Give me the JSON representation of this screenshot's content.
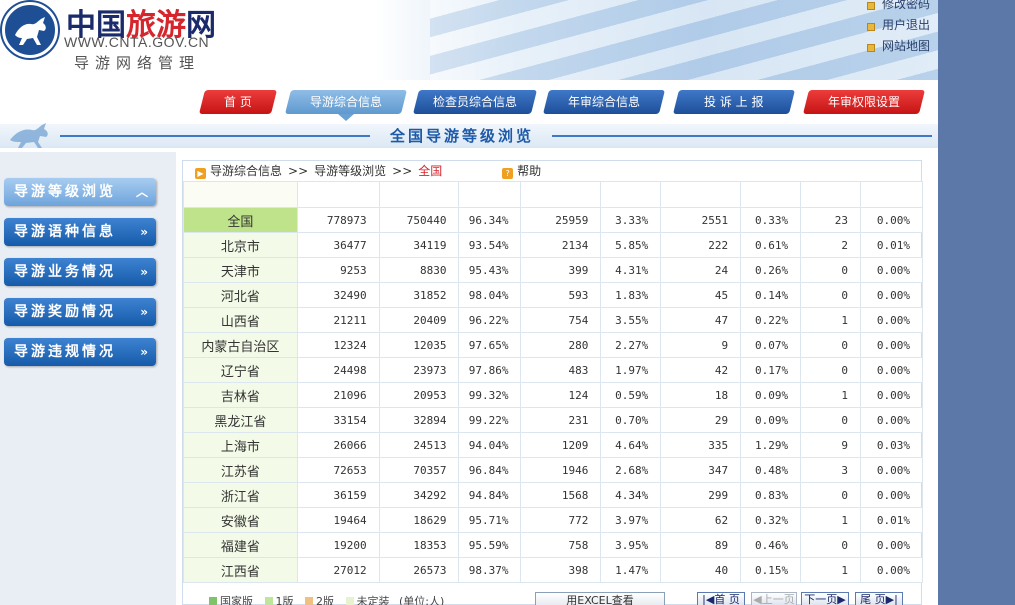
{
  "header": {
    "logo_cn_part1": "中国",
    "logo_cn_part2": "旅游",
    "logo_cn_part3": "网",
    "logo_url": "WWW.CNTA.GOV.CN",
    "logo_sub": "导游网络管理",
    "links": [
      "修改密码",
      "用户退出",
      "网站地图"
    ]
  },
  "nav": {
    "items": [
      "首 页",
      "导游综合信息",
      "检查员综合信息",
      "年审综合信息",
      "投 诉 上 报",
      "年审权限设置"
    ],
    "page_title": "全国导游等级浏览"
  },
  "sidebar": {
    "items": [
      "导游等级浏览",
      "导游语种信息",
      "导游业务情况",
      "导游奖励情况",
      "导游违规情况"
    ]
  },
  "breadcrumb": {
    "a": "导游综合信息",
    "sep": ">>",
    "b": "导游等级浏览",
    "current": "全国",
    "help": "帮助"
  },
  "table": {
    "rows": [
      [
        "全国",
        "778973",
        "750440",
        "96.34%",
        "25959",
        "3.33%",
        "2551",
        "0.33%",
        "23",
        "0.00%"
      ],
      [
        "北京市",
        "36477",
        "34119",
        "93.54%",
        "2134",
        "5.85%",
        "222",
        "0.61%",
        "2",
        "0.01%"
      ],
      [
        "天津市",
        "9253",
        "8830",
        "95.43%",
        "399",
        "4.31%",
        "24",
        "0.26%",
        "0",
        "0.00%"
      ],
      [
        "河北省",
        "32490",
        "31852",
        "98.04%",
        "593",
        "1.83%",
        "45",
        "0.14%",
        "0",
        "0.00%"
      ],
      [
        "山西省",
        "21211",
        "20409",
        "96.22%",
        "754",
        "3.55%",
        "47",
        "0.22%",
        "1",
        "0.00%"
      ],
      [
        "内蒙古自治区",
        "12324",
        "12035",
        "97.65%",
        "280",
        "2.27%",
        "9",
        "0.07%",
        "0",
        "0.00%"
      ],
      [
        "辽宁省",
        "24498",
        "23973",
        "97.86%",
        "483",
        "1.97%",
        "42",
        "0.17%",
        "0",
        "0.00%"
      ],
      [
        "吉林省",
        "21096",
        "20953",
        "99.32%",
        "124",
        "0.59%",
        "18",
        "0.09%",
        "1",
        "0.00%"
      ],
      [
        "黑龙江省",
        "33154",
        "32894",
        "99.22%",
        "231",
        "0.70%",
        "29",
        "0.09%",
        "0",
        "0.00%"
      ],
      [
        "上海市",
        "26066",
        "24513",
        "94.04%",
        "1209",
        "4.64%",
        "335",
        "1.29%",
        "9",
        "0.03%"
      ],
      [
        "江苏省",
        "72653",
        "70357",
        "96.84%",
        "1946",
        "2.68%",
        "347",
        "0.48%",
        "3",
        "0.00%"
      ],
      [
        "浙江省",
        "36159",
        "34292",
        "94.84%",
        "1568",
        "4.34%",
        "299",
        "0.83%",
        "0",
        "0.00%"
      ],
      [
        "安徽省",
        "19464",
        "18629",
        "95.71%",
        "772",
        "3.97%",
        "62",
        "0.32%",
        "1",
        "0.01%"
      ],
      [
        "福建省",
        "19200",
        "18353",
        "95.59%",
        "758",
        "3.95%",
        "89",
        "0.46%",
        "0",
        "0.00%"
      ],
      [
        "江西省",
        "27012",
        "26573",
        "98.37%",
        "398",
        "1.47%",
        "40",
        "0.15%",
        "1",
        "0.00%"
      ]
    ]
  },
  "footer": {
    "legend": [
      "国家版",
      "1版",
      "2版",
      "未定装"
    ],
    "unit": "(单位:人)",
    "excel_label": "用EXCEL查看",
    "first": "首 页",
    "prev": "上一页",
    "next": "下一页",
    "last": "尾 页"
  },
  "colors": {
    "nav_red": "#d41c1c",
    "nav_blue": "#1e4f99",
    "menu_blue": "#165aaa",
    "total_row": "#bfe38a",
    "name_col": "#f3fbe8",
    "side_bg": "#5b78a8"
  }
}
